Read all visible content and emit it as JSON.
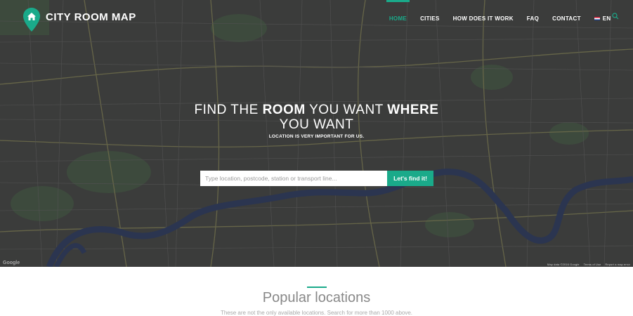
{
  "brand": {
    "name": "CITY ROOM MAP"
  },
  "colors": {
    "accent": "#1aaa8a",
    "hero_overlay": "#3a3b3a",
    "water": "#2b3550"
  },
  "nav": {
    "items": [
      {
        "label": "HOME",
        "active": true
      },
      {
        "label": "CITIES"
      },
      {
        "label": "HOW DOES IT WORK"
      },
      {
        "label": "FAQ"
      },
      {
        "label": "CONTACT"
      }
    ],
    "language": "EN"
  },
  "hero": {
    "title_part1": "FIND THE ",
    "title_bold1": "ROOM",
    "title_part2": " YOU WANT ",
    "title_bold2": "WHERE",
    "title_line2": "YOU WANT",
    "subtitle": "LOCATION IS VERY IMPORTANT FOR US.",
    "search_placeholder": "Type location, postcode, station or transport line...",
    "search_button": "Let's find it!",
    "map_credit": "Map data ©2016 Google",
    "map_terms": "Terms of Use",
    "map_report": "Report a map error",
    "map_provider": "Google"
  },
  "popular": {
    "title": "Popular locations",
    "subtitle": "These are not the only available locations. Search for more than 1000 above."
  }
}
